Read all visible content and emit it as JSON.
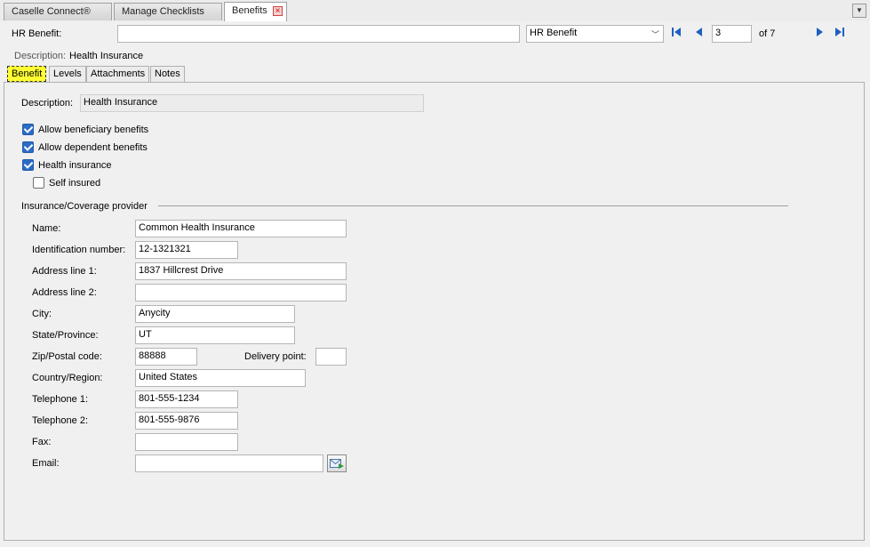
{
  "doc_tabs": [
    {
      "label": "Caselle Connect®"
    },
    {
      "label": "Manage Checklists"
    },
    {
      "label": "Benefits"
    }
  ],
  "header": {
    "hr_benefit_label": "HR Benefit:",
    "hr_benefit_value": "",
    "type_select_value": "HR Benefit",
    "record_number": "3",
    "record_total": "of 7",
    "description_label": "Description:",
    "description_value": "Health Insurance"
  },
  "sub_tabs": [
    {
      "label": "Benefit"
    },
    {
      "label": "Levels"
    },
    {
      "label": "Attachments"
    },
    {
      "label": "Notes"
    }
  ],
  "benefit": {
    "description_label": "Description:",
    "description_value": "Health Insurance",
    "checkboxes": [
      {
        "label": "Allow beneficiary benefits",
        "checked": true
      },
      {
        "label": "Allow dependent benefits",
        "checked": true
      },
      {
        "label": "Health insurance",
        "checked": true
      },
      {
        "label": "Self insured",
        "checked": false
      }
    ],
    "group_title": "Insurance/Coverage provider",
    "fields": {
      "name": {
        "label": "Name:",
        "value": "Common Health Insurance"
      },
      "id_number": {
        "label": "Identification number:",
        "value": "12-1321321"
      },
      "address1": {
        "label": "Address line 1:",
        "value": "1837 Hillcrest Drive"
      },
      "address2": {
        "label": "Address line 2:",
        "value": ""
      },
      "city": {
        "label": "City:",
        "value": "Anycity"
      },
      "state": {
        "label": "State/Province:",
        "value": "UT"
      },
      "zip": {
        "label": "Zip/Postal code:",
        "value": "88888"
      },
      "delivery_point": {
        "label": "Delivery point:",
        "value": ""
      },
      "country": {
        "label": "Country/Region:",
        "value": "United States"
      },
      "telephone1": {
        "label": "Telephone 1:",
        "value": "801-555-1234"
      },
      "telephone2": {
        "label": "Telephone 2:",
        "value": "801-555-9876"
      },
      "fax": {
        "label": "Fax:",
        "value": ""
      },
      "email": {
        "label": "Email:",
        "value": ""
      }
    }
  },
  "icons": {
    "first": "first-record-icon",
    "prev": "previous-record-icon",
    "next": "next-record-icon",
    "last": "last-record-icon",
    "email": "send-email-icon"
  },
  "colors": {
    "accent": "#1f5fbf",
    "active_tab_highlight": "#ffff33",
    "checkbox": "#2b6cc4"
  }
}
